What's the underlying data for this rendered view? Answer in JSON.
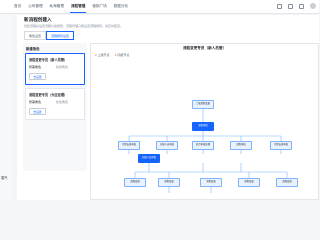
{
  "nav": {
    "items": [
      "首页",
      "公司管理",
      "私海管理",
      "流程管理",
      "营销广场",
      "数据分析"
    ],
    "active_index": 3
  },
  "page": {
    "title": "新流程创建入",
    "desc": "创建流程并设置流程分发规则，流程管理只能设置流程规则，请及时配置。"
  },
  "tabs": [
    "角色设置",
    "流程规则设置"
  ],
  "panel": {
    "title": "新建角色",
    "roles": [
      {
        "name": "流程变更专员（新人员管）",
        "key": "所需角色",
        "value": "新建角色",
        "button": "去设置"
      },
      {
        "name": "流程变更专员（大区经理）",
        "key": "所需角色",
        "value": "新建角色",
        "button": "去设置"
      }
    ]
  },
  "canvas": {
    "title": "流程变更专员（新人员管）",
    "legend": [
      {
        "num": "2",
        "text": "上级节点"
      },
      {
        "num": "3",
        "text": "同级节点"
      }
    ],
    "root": "上级流程变更",
    "level2": "流程审批",
    "level3": [
      "行程安排审批",
      "分配人员审批",
      "综合审批处理",
      "流程审核",
      "行程安排审批",
      "分配人员审批"
    ],
    "level4": [
      "流程变更",
      "流程变更",
      "流程变更",
      "流程变更",
      "流程变更"
    ]
  },
  "brand": {
    "logo_text": "蒸汽"
  },
  "colors": {
    "accent": "#1664ff",
    "line": "#7fb2ff"
  }
}
